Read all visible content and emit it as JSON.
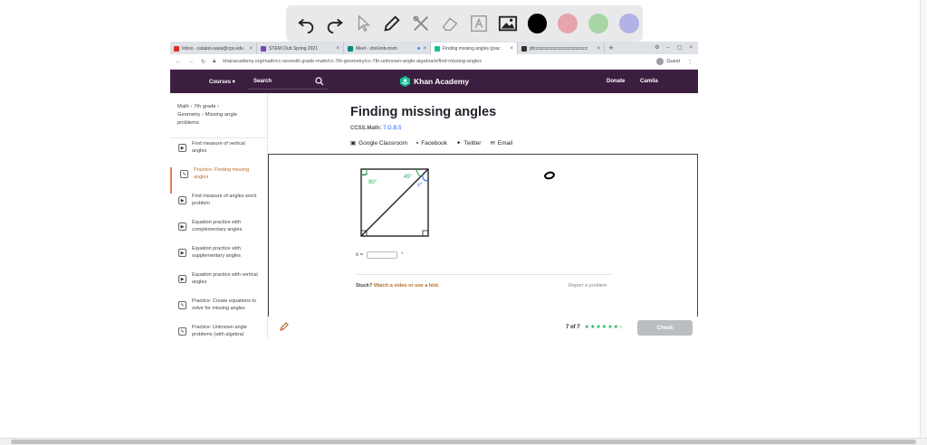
{
  "annotation_toolbar": {
    "tools": [
      "undo-icon",
      "redo-icon",
      "pointer-icon",
      "pencil-icon",
      "tools-icon",
      "eraser-icon",
      "text-icon",
      "image-icon"
    ],
    "colors": [
      "#000000",
      "#e8a4ad",
      "#a8d5a6",
      "#b2b2e6"
    ]
  },
  "browser": {
    "tabs": [
      {
        "label": "Inbox - catalan-sarai@cps.edu",
        "favicon_color": "#d93025"
      },
      {
        "label": "STEM Club Spring 2021",
        "favicon_color": "#7248b9"
      },
      {
        "label": "Meet - xbd-knb-mxm",
        "favicon_color": "#00897b"
      },
      {
        "label": "Finding missing angles (prac",
        "favicon_color": "#14bf96"
      },
      {
        "label": "pfcccccccccccccccccccccccc",
        "favicon_color": "#333333"
      }
    ],
    "url": "khanacademy.org/math/cc-seventh-grade-math/cc-7th-geometry/cc-7th-unknown-angle-algebra/e/find-missing-angles",
    "profile": "Guest"
  },
  "header": {
    "courses": "Courses",
    "search": "Search",
    "brand": "Khan Academy",
    "donate": "Donate",
    "user": "Camila"
  },
  "breadcrumb": {
    "part1": "Math",
    "part2": "7th grade",
    "part3": "Geometry",
    "part4": "Missing angle problems"
  },
  "sidebar": {
    "items": [
      {
        "label": "Find measure of vertical angles",
        "icon": "video-icon"
      },
      {
        "label": "Practice: Finding missing angles",
        "icon": "pencil-icon"
      },
      {
        "label": "Find measure of angles word problem",
        "icon": "video-icon"
      },
      {
        "label": "Equation practice with complementary angles",
        "icon": "video-icon"
      },
      {
        "label": "Equation practice with supplementary angles",
        "icon": "video-icon"
      },
      {
        "label": "Equation practice with vertical angles",
        "icon": "video-icon"
      },
      {
        "label": "Practice: Create equations to solve for missing angles",
        "icon": "pencil-icon"
      },
      {
        "label": "Practice: Unknown angle problems (with algebra)",
        "icon": "pencil-icon"
      }
    ]
  },
  "main": {
    "title": "Finding missing angles",
    "ccss_prefix": "CCSS.Math:",
    "ccss_code": "7.G.B.5",
    "share": {
      "classroom": "Google Classroom",
      "facebook": "Facebook",
      "twitter": "Twitter",
      "email": "Email"
    }
  },
  "problem": {
    "angle_90": "90°",
    "angle_45": "45°",
    "angle_x": "x°",
    "answer_label": "x =",
    "answer_value": "",
    "degree_suffix": "°",
    "stuck": "Stuck?",
    "hint_link": "Watch a video or use a hint.",
    "report": "Report a problem"
  },
  "footer": {
    "progress": "7 of 7",
    "stars": "★★★★★★○",
    "check": "Check"
  }
}
